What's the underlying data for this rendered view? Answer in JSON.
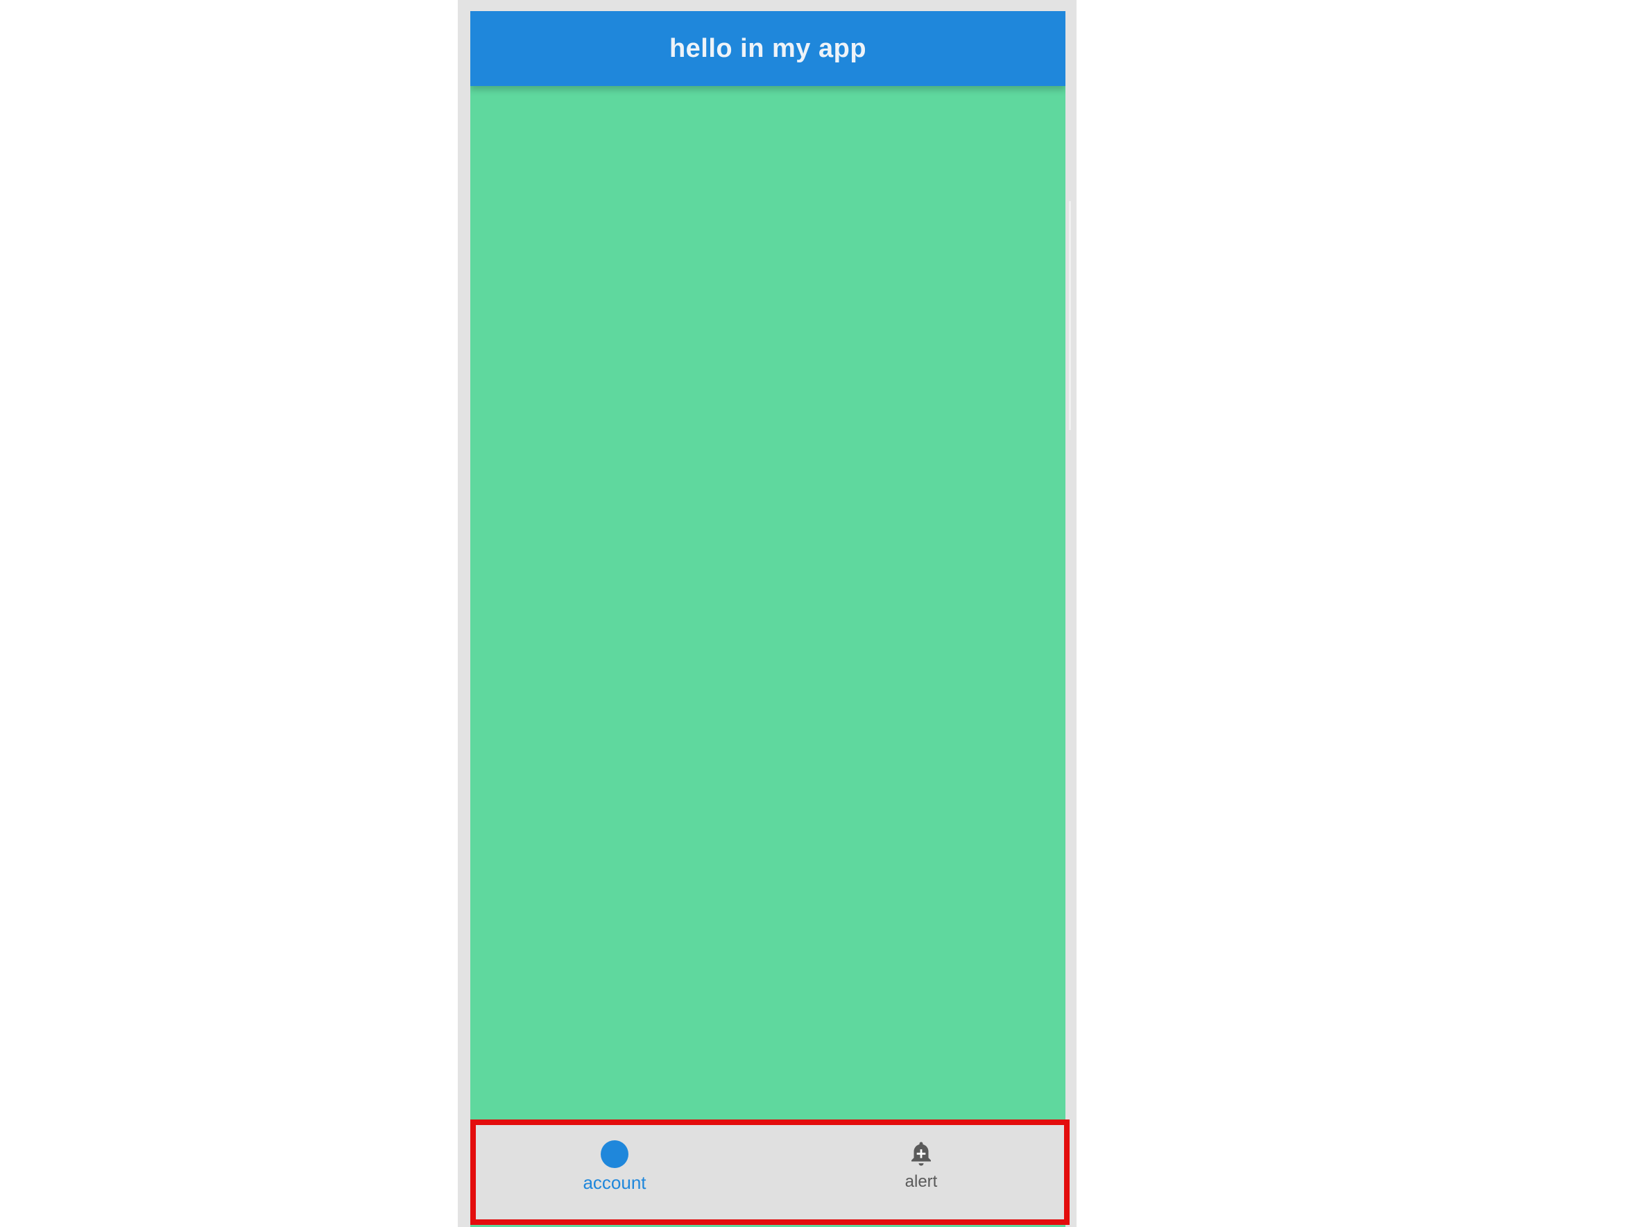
{
  "app_bar": {
    "title": "hello in my app"
  },
  "bottom_nav": {
    "items": [
      {
        "label": "account",
        "icon": "account-circle-icon",
        "active": true
      },
      {
        "label": "alert",
        "icon": "bell-plus-icon",
        "active": false
      }
    ],
    "highlight_color": "#e30d0d"
  },
  "colors": {
    "app_bar": "#1f87db",
    "body": "#5fd89e",
    "nav_background": "#e0e0e0",
    "active": "#1f87db",
    "inactive": "#5a5a5a"
  }
}
